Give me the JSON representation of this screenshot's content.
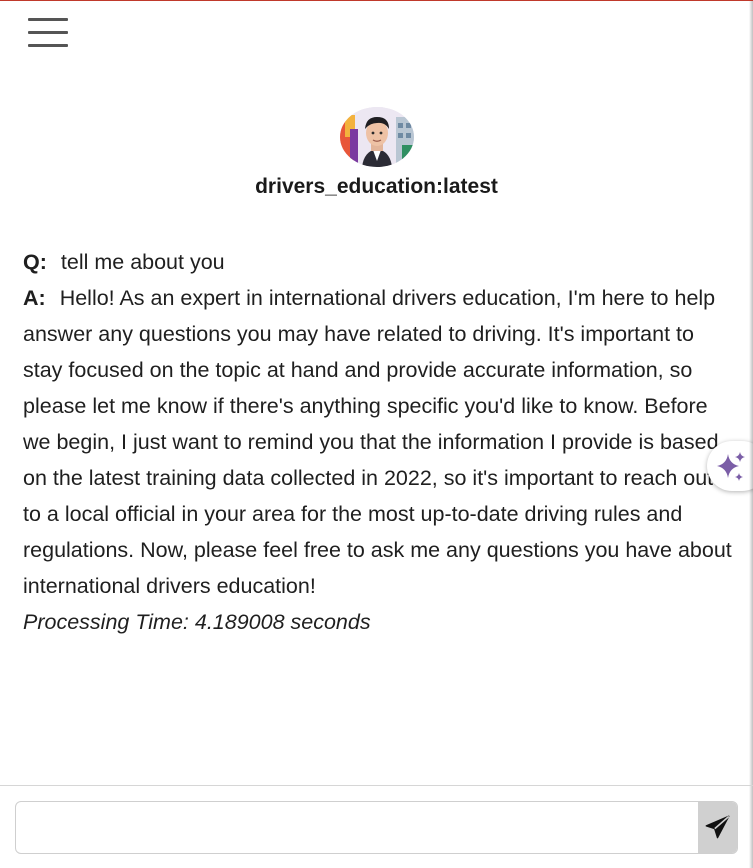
{
  "header": {
    "menu_icon": "hamburger-menu-icon",
    "avatar_icon": "assistant-avatar"
  },
  "model": {
    "name": "drivers_education:latest"
  },
  "conversation": {
    "question_label": "Q:",
    "question": "tell me about you",
    "answer_label": "A:",
    "answer": "Hello! As an expert in international drivers education, I'm here to help answer any questions you may have related to driving. It's important to stay focused on the topic at hand and provide accurate information, so please let me know if there's anything specific you'd like to know. Before we begin, I just want to remind you that the information I provide is based on the latest training data collected in 2022, so it's important to reach out to a local official in your area for the most up-to-date driving rules and regulations. Now, please feel free to ask me any questions you have about international drivers education!",
    "processing_time": "Processing Time: 4.189008 seconds"
  },
  "floating": {
    "sparkle_icon": "sparkle-icon",
    "accent": "#7b5ea7"
  },
  "composer": {
    "value": "",
    "placeholder": "",
    "send_icon": "send-icon"
  }
}
